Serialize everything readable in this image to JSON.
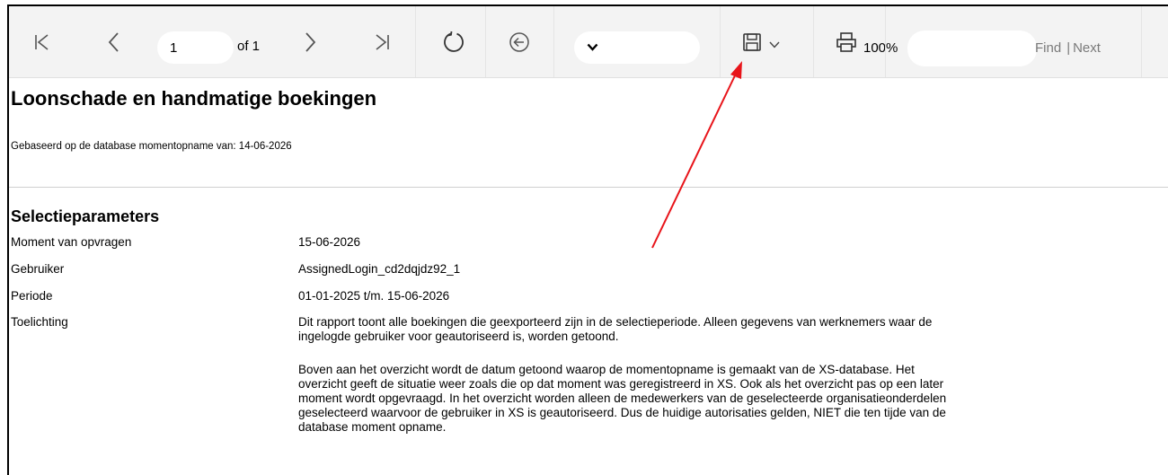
{
  "toolbar": {
    "page_current": "1",
    "page_of": "of 1",
    "zoom": "100%",
    "find_label": "Find",
    "next_label": "Next",
    "separator": "|",
    "search_value": ""
  },
  "icons": {
    "first": "first-page-icon",
    "prev": "previous-page-icon",
    "next": "next-page-icon",
    "last": "last-page-icon",
    "refresh": "refresh-icon",
    "back": "back-icon",
    "save": "save-icon",
    "print": "print-icon",
    "dropdown": "chevron-down-icon"
  },
  "report": {
    "title": "Loonschade en handmatige boekingen",
    "based_on": "Gebaseerd op de database momentopname van: 14-06-2026",
    "section_title": "Selectieparameters",
    "params": [
      {
        "label": "Moment van opvragen",
        "value": "15-06-2026"
      },
      {
        "label": "Gebruiker",
        "value": "AssignedLogin_cd2dqjdz92_1"
      },
      {
        "label": "Periode",
        "value": "01-01-2025 t/m. 15-06-2026"
      },
      {
        "label": "Toelichting",
        "value": ""
      }
    ],
    "explanation": [
      "Dit rapport toont alle boekingen die geexporteerd zijn in de selectieperiode. Alleen gegevens van werknemers waar de ingelogde gebruiker voor geautoriseerd is, worden getoond.",
      "Boven aan het overzicht wordt de datum getoond waarop de momentopname is gemaakt van de XS-database. Het overzicht geeft de situatie weer zoals die op dat moment was geregistreerd in XS. Ook als het overzicht pas op een later moment wordt opgevraagd. In het overzicht worden alleen de medewerkers van de geselecteerde organisatieonderdelen geselecteerd waarvoor de gebruiker in XS is geautoriseerd. Dus de huidige autorisaties gelden, NIET die ten tijde van de database moment opname."
    ]
  },
  "colors": {
    "toolbar_bg": "#f3f3f3",
    "annotation_arrow": "#e8141a"
  }
}
